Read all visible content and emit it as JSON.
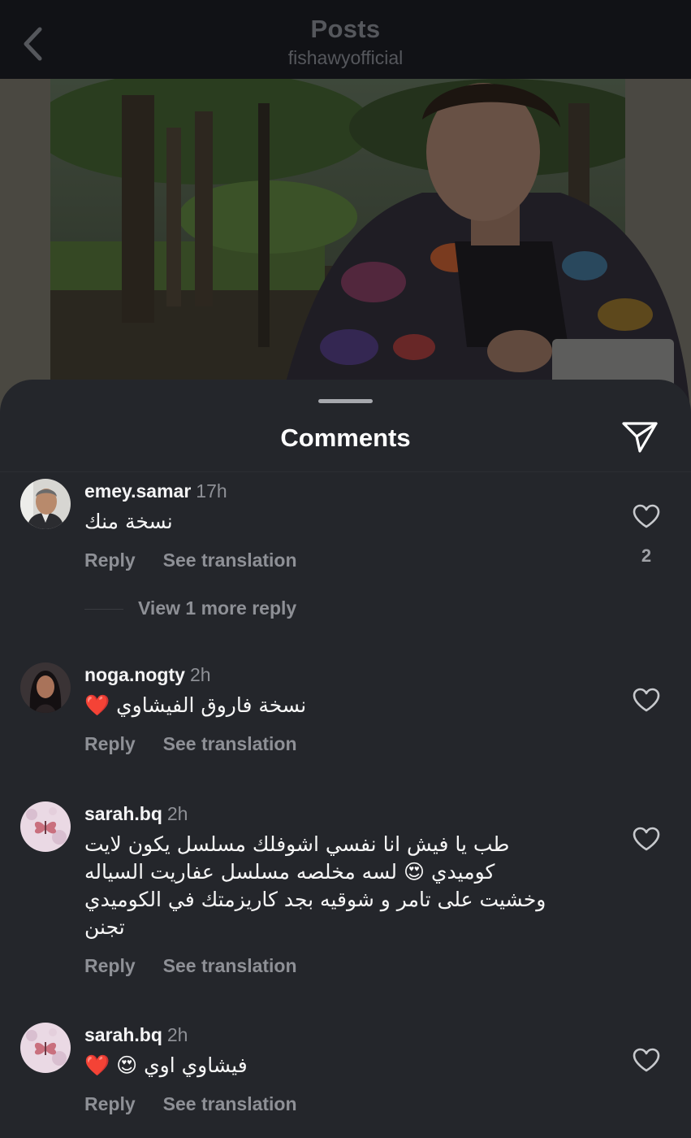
{
  "header": {
    "title": "Posts",
    "subtitle": "fishawyofficial"
  },
  "sheet": {
    "title": "Comments"
  },
  "comments": [
    {
      "username": "emey.samar",
      "time": "17h",
      "text": "نسخة منك",
      "reply_label": "Reply",
      "translate_label": "See translation",
      "likes": "2",
      "view_replies": "View 1 more reply"
    },
    {
      "username": "noga.nogty",
      "time": "2h",
      "text": "نسخة فاروق الفيشاوي ❤️",
      "reply_label": "Reply",
      "translate_label": "See translation"
    },
    {
      "username": "sarah.bq",
      "time": "2h",
      "text_line1": "طب يا فيش انا نفسي اشوفلك مسلسل يكون لايت",
      "text_line2": "كوميدي 😍 لسه مخلصه مسلسل عفاريت السياله",
      "text_line3": "وخشيت على تامر و شوقيه بجد كاريزمتك في الكوميدي",
      "text_line4": "تجنن",
      "reply_label": "Reply",
      "translate_label": "See translation"
    },
    {
      "username": "sarah.bq",
      "time": "2h",
      "text": "فيشاوي اوي 😍 ❤️",
      "reply_label": "Reply",
      "translate_label": "See translation"
    }
  ],
  "icons": {
    "back": "chevron-left-icon",
    "share": "paper-plane-icon",
    "like": "heart-outline-icon"
  },
  "colors": {
    "sheet_background": "#24262b",
    "top_bar": "#111216",
    "secondary_text": "#8e9096",
    "heart_emoji": "#e0245e"
  }
}
